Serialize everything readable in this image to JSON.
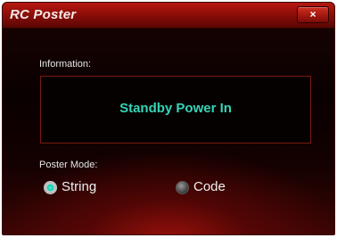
{
  "window": {
    "title": "RC Poster",
    "close_icon": "×"
  },
  "information": {
    "label": "Information:",
    "value": "Standby Power In"
  },
  "poster_mode": {
    "label": "Poster Mode:",
    "options": [
      {
        "label": "String",
        "selected": true,
        "icon": "radio-checked-icon"
      },
      {
        "label": "Code",
        "selected": false,
        "icon": "radio-unchecked-icon"
      }
    ]
  },
  "colors": {
    "accent": "#35d4b8",
    "titlebar": "#a31810",
    "background": "#0a0000"
  }
}
